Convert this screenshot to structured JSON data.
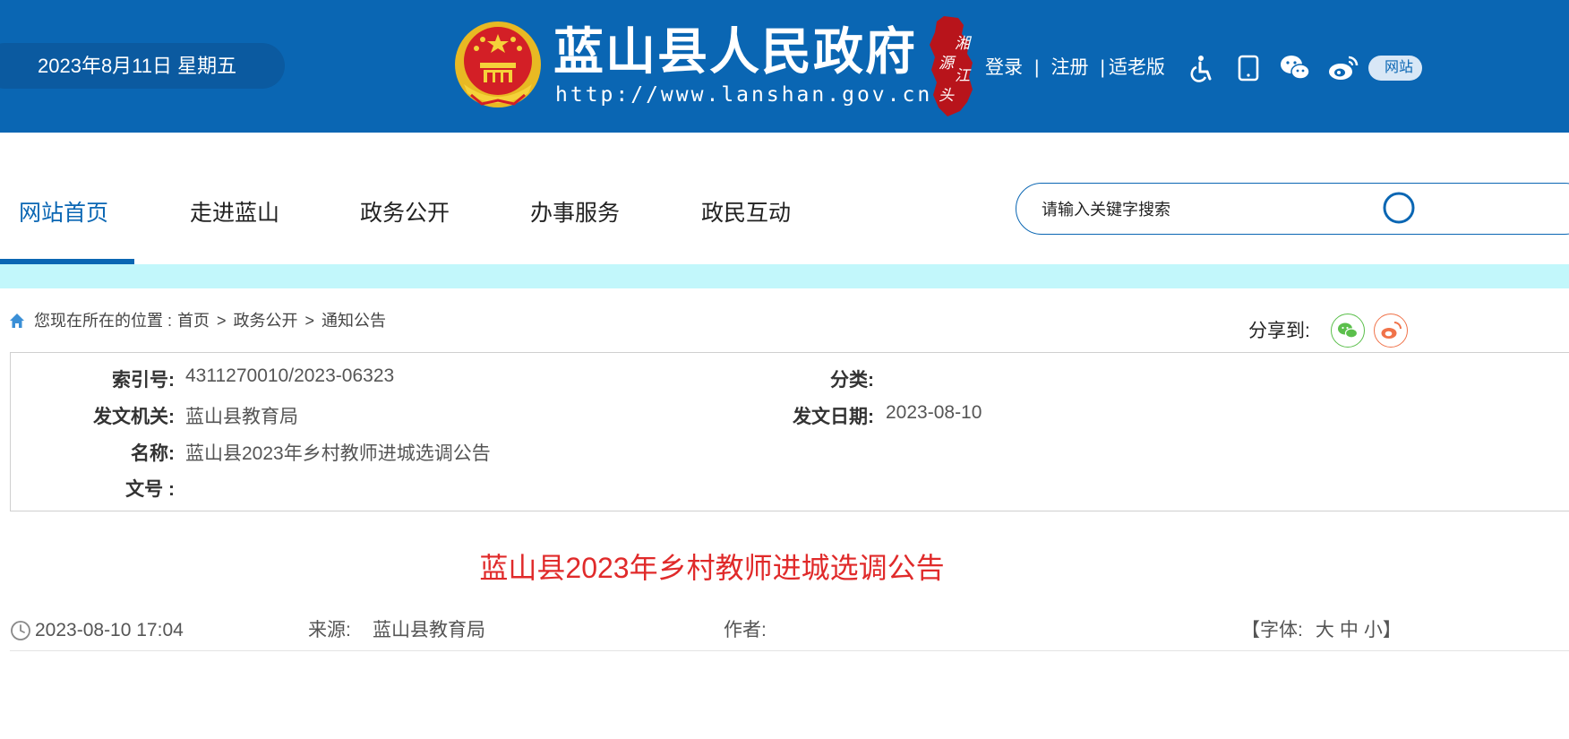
{
  "header": {
    "date": "2023年8月11日 星期五",
    "site_title": "蓝山县人民政府",
    "site_url": "http://www.lanshan.gov.cn",
    "seal_text": "湘江源头",
    "links": {
      "login": "登录",
      "register": "注册",
      "elderly": "适老版"
    },
    "sep1": "|",
    "sep2": "|",
    "pill_text": "网站",
    "icons": [
      "accessibility-icon",
      "tablet-icon",
      "wechat-icon",
      "weibo-icon"
    ],
    "colors": {
      "brand_blue": "#0a66b3",
      "seal_red": "#b8141b"
    }
  },
  "nav": {
    "items": [
      {
        "label": "网站首页",
        "active": true
      },
      {
        "label": "走进蓝山"
      },
      {
        "label": "政务公开"
      },
      {
        "label": "办事服务"
      },
      {
        "label": "政民互动"
      }
    ],
    "search_placeholder": "请输入关键字搜索"
  },
  "breadcrumb": {
    "prefix": "您现在所在的位置 :",
    "items": [
      "首页",
      "政务公开",
      "通知公告"
    ],
    "separator": ">"
  },
  "share": {
    "label": "分享到:"
  },
  "info": {
    "index_label": "索引号:",
    "index_value": "4311270010/2023-06323",
    "category_label": "分类:",
    "category_value": "",
    "issuer_label": "发文机关:",
    "issuer_value": "蓝山县教育局",
    "date_label": "发文日期:",
    "date_value": "2023-08-10",
    "name_label": "名称:",
    "name_value": "蓝山县2023年乡村教师进城选调公告",
    "docno_label": "文号 :",
    "docno_value": ""
  },
  "article": {
    "title": "蓝山县2023年乡村教师进城选调公告",
    "datetime": "2023-08-10 17:04",
    "source_label": "来源:",
    "source_value": "蓝山县教育局",
    "author_label": "作者:",
    "author_value": "",
    "font_size_label": "【字体:",
    "font_large": "大",
    "font_medium": "中",
    "font_small": "小】",
    "title_color": "#e02a2a"
  }
}
